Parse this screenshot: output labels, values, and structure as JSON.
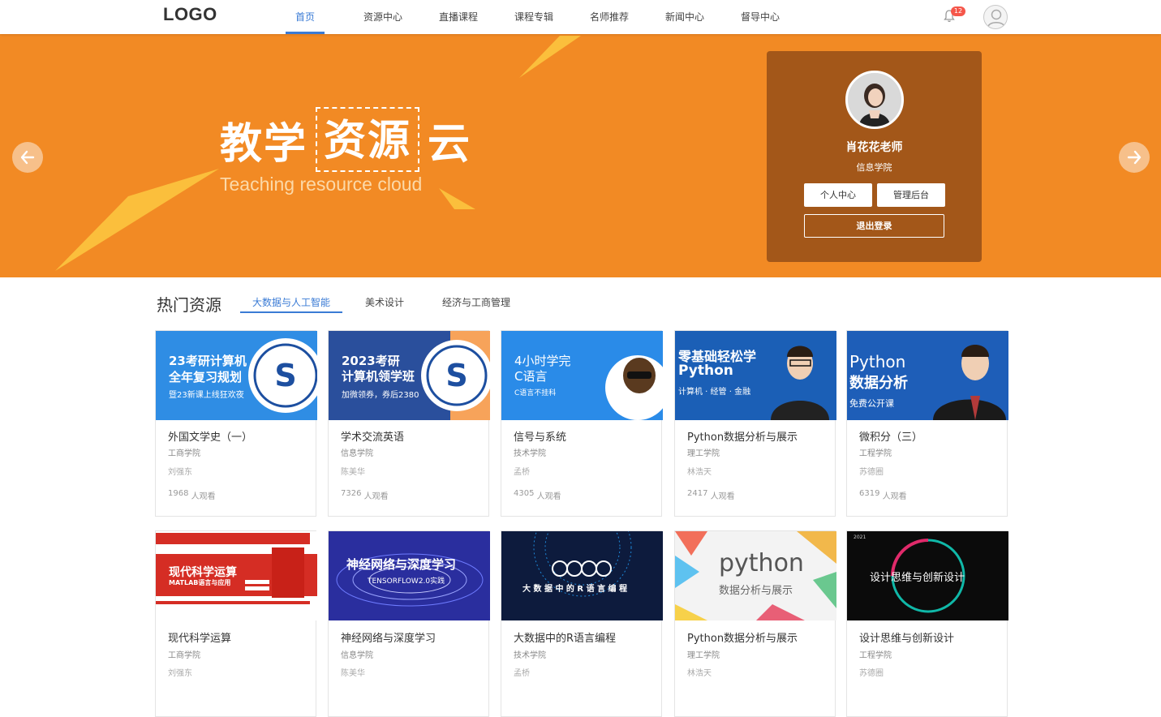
{
  "header": {
    "logo": "LOGO",
    "nav": [
      {
        "label": "首页",
        "active": true
      },
      {
        "label": "资源中心",
        "active": false
      },
      {
        "label": "直播课程",
        "active": false
      },
      {
        "label": "课程专辑",
        "active": false
      },
      {
        "label": "名师推荐",
        "active": false
      },
      {
        "label": "新闻中心",
        "active": false
      },
      {
        "label": "督导中心",
        "active": false
      }
    ],
    "notification_count": "12",
    "icons": {
      "bell": "bell-icon",
      "avatar": "user-avatar-icon"
    }
  },
  "banner": {
    "title_left": "教学",
    "title_boxed": "资源",
    "title_right": "云",
    "subtitle": "Teaching resource cloud",
    "colors": {
      "background": "#f28a24",
      "accent": "#fbbf3c"
    }
  },
  "profile": {
    "name": "肖花花老师",
    "dept": "信息学院",
    "personal_center": "个人中心",
    "admin_backend": "管理后台",
    "logout": "退出登录",
    "card_color": "#a35719"
  },
  "hot": {
    "title": "热门资源",
    "tabs": [
      {
        "label": "大数据与人工智能",
        "active": true
      },
      {
        "label": "美术设计",
        "active": false
      },
      {
        "label": "经济与工商管理",
        "active": false
      }
    ],
    "views_suffix": "人观看",
    "cards": [
      {
        "title": "外国文学史（一）",
        "dept": "工商学院",
        "teacher": "刘强东",
        "views": "1968",
        "thumb": {
          "line1": "23考研计算机",
          "line2": "全年复习规划",
          "line3": "暨23新课上线狂欢夜"
        }
      },
      {
        "title": "学术交流英语",
        "dept": "信息学院",
        "teacher": "陈美华",
        "views": "7326",
        "thumb": {
          "line1": "2023考研",
          "line2": "计算机领学班",
          "line3": "加微领券，券后2380"
        }
      },
      {
        "title": "信号与系统",
        "dept": "技术学院",
        "teacher": "孟桥",
        "views": "4305",
        "thumb": {
          "line1": "4小时学完",
          "line2": "C语言",
          "line3": "C语言不挂科"
        }
      },
      {
        "title": "Python数据分析与展示",
        "dept": "理工学院",
        "teacher": "林浩天",
        "views": "2417",
        "thumb": {
          "line1": "零基础轻松学",
          "line2": "Python",
          "line3": "计算机 · 经管 · 金融"
        }
      },
      {
        "title": "微积分（三）",
        "dept": "工程学院",
        "teacher": "苏德圈",
        "views": "6319",
        "thumb": {
          "line1": "Python",
          "line2": "数据分析",
          "line3": "免费公开课"
        }
      },
      {
        "title": "现代科学运算",
        "dept": "工商学院",
        "teacher": "刘强东",
        "thumb": {
          "line1": "现代科学运算",
          "line2": "MATLAB语言与应用"
        }
      },
      {
        "title": "神经网络与深度学习",
        "dept": "信息学院",
        "teacher": "陈美华",
        "thumb": {
          "line1": "神经网络与深度学习",
          "line2": "TENSORFLOW2.0实践"
        }
      },
      {
        "title": "大数据中的R语言编程",
        "dept": "技术学院",
        "teacher": "孟桥",
        "thumb": {
          "line1": "2019",
          "line2": "大 数 据 中 的 R 语 言 编 程"
        }
      },
      {
        "title": "Python数据分析与展示",
        "dept": "理工学院",
        "teacher": "林浩天",
        "thumb": {
          "line1": "python",
          "line2": "数据分析与展示"
        }
      },
      {
        "title": "设计思维与创新设计",
        "dept": "工程学院",
        "teacher": "苏德圈",
        "thumb": {
          "line1": "设计思维与创新设计",
          "line2": "2021"
        }
      }
    ]
  }
}
